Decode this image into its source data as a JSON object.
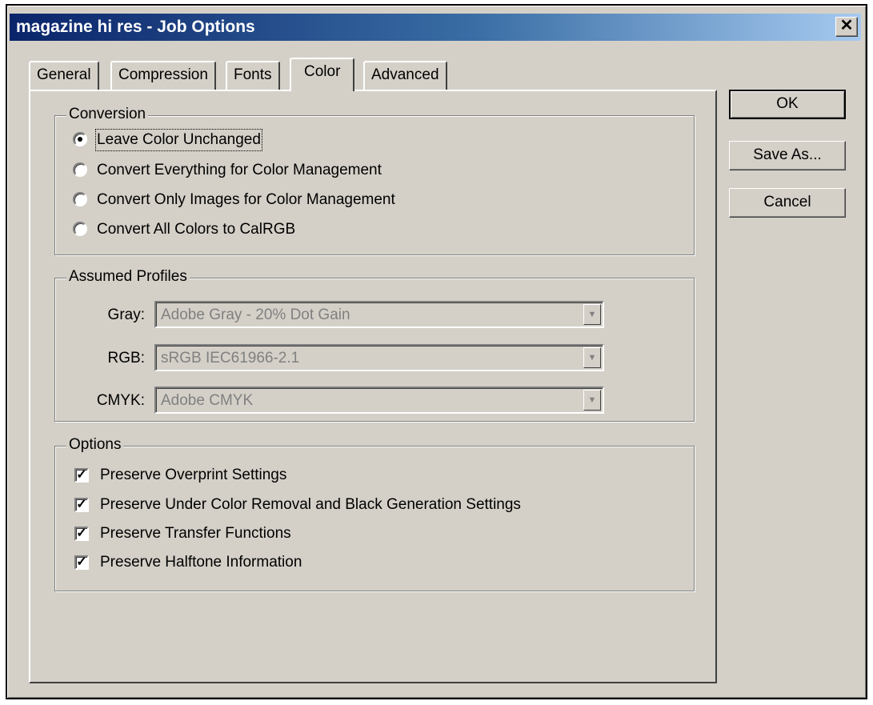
{
  "window": {
    "title": "magazine hi res - Job Options",
    "close_glyph": "✕"
  },
  "tabs": [
    {
      "label": "General",
      "active": false
    },
    {
      "label": "Compression",
      "active": false
    },
    {
      "label": "Fonts",
      "active": false
    },
    {
      "label": "Color",
      "active": true
    },
    {
      "label": "Advanced",
      "active": false
    }
  ],
  "conversion": {
    "title": "Conversion",
    "options": [
      {
        "label": "Leave Color Unchanged",
        "selected": true
      },
      {
        "label": "Convert Everything for Color Management",
        "selected": false
      },
      {
        "label": "Convert Only Images for Color Management",
        "selected": false
      },
      {
        "label": "Convert All Colors to CalRGB",
        "selected": false
      }
    ]
  },
  "profiles": {
    "title": "Assumed Profiles",
    "gray": {
      "label": "Gray:",
      "value": "Adobe Gray - 20% Dot Gain"
    },
    "rgb": {
      "label": "RGB:",
      "value": "sRGB IEC61966-2.1"
    },
    "cmyk": {
      "label": "CMYK:",
      "value": "Adobe CMYK"
    }
  },
  "options": {
    "title": "Options",
    "items": [
      {
        "label": "Preserve Overprint Settings",
        "checked": true
      },
      {
        "label": "Preserve Under Color Removal and Black Generation Settings",
        "checked": true
      },
      {
        "label": "Preserve Transfer Functions",
        "checked": true
      },
      {
        "label": "Preserve Halftone Information",
        "checked": true
      }
    ]
  },
  "buttons": {
    "ok": "OK",
    "save_as": "Save As...",
    "cancel": "Cancel"
  }
}
